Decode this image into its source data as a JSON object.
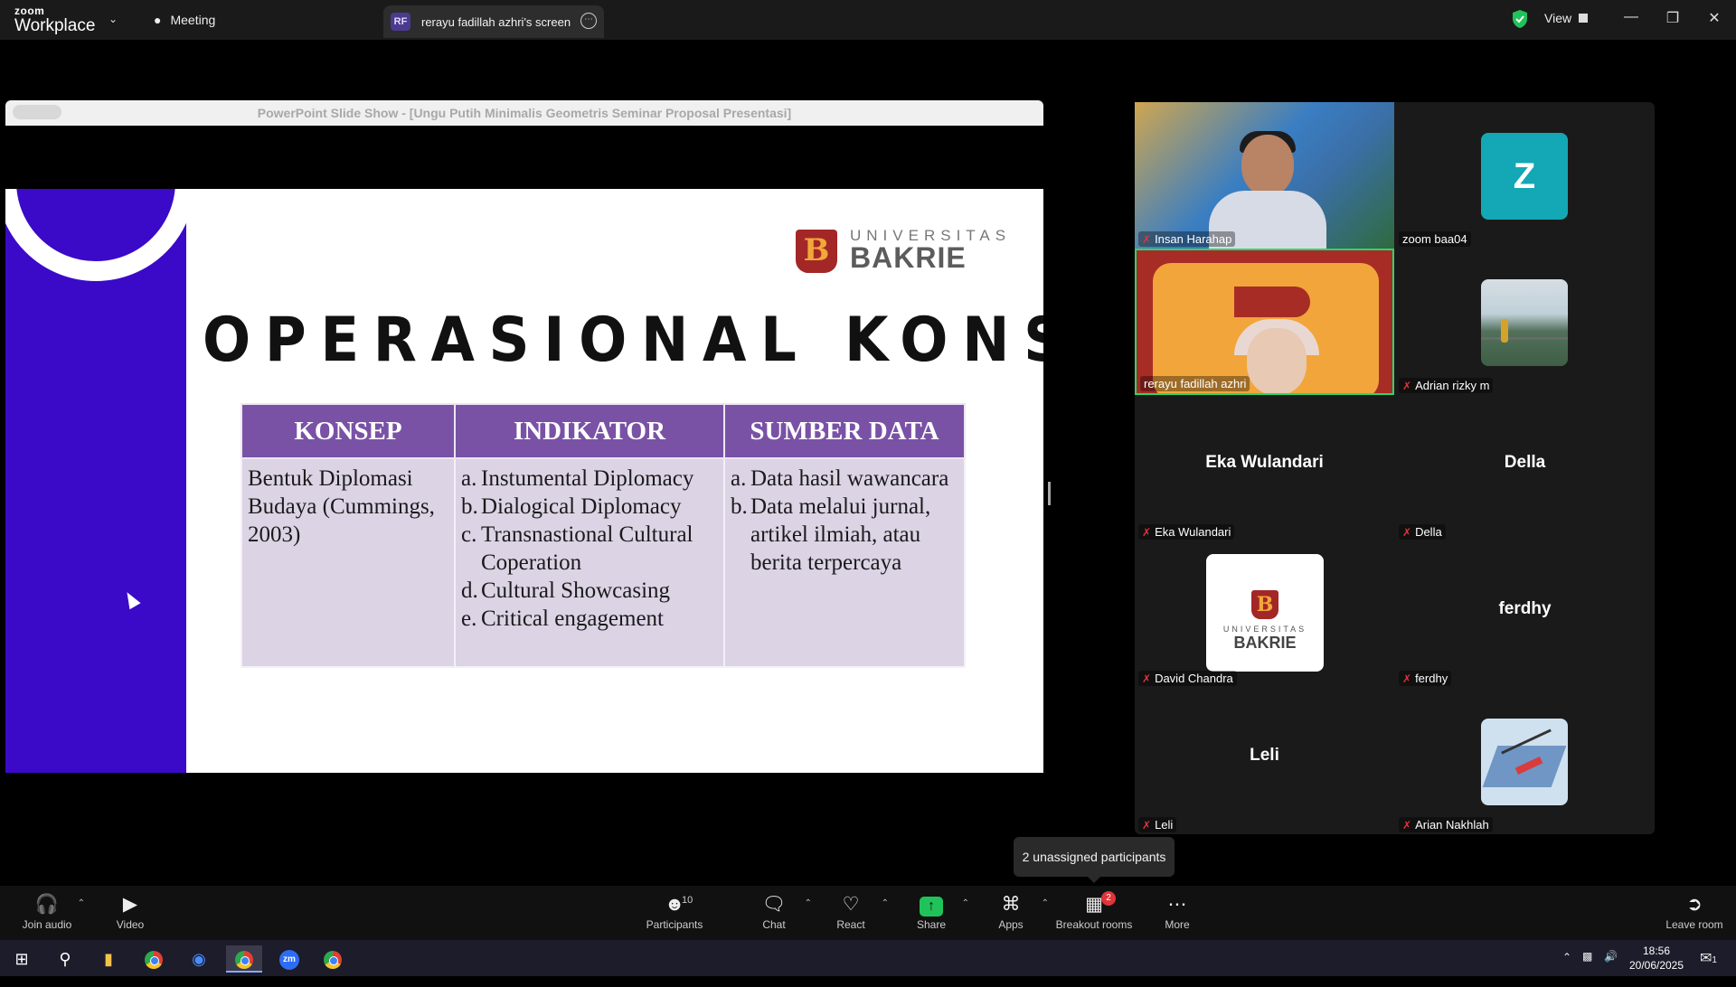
{
  "app": {
    "logo_top": "zoom",
    "logo_bottom": "Workplace"
  },
  "tabs": {
    "meeting": "Meeting",
    "screen_badge": "RF",
    "screen_tab": "rerayu fadillah azhri's screen"
  },
  "titlebar": {
    "view_label": "View"
  },
  "shared_window": {
    "title": "PowerPoint Slide Show - [Ungu Putih Minimalis Geometris Seminar Proposal Presentasi]",
    "slide": {
      "heading": "OPERASIONAL KONSEP",
      "logo_line1": "UNIVERSITAS",
      "logo_line2": "BAKRIE",
      "logo_mark": "B",
      "table": {
        "headers": [
          "KONSEP",
          "INDIKATOR",
          "SUMBER DATA"
        ],
        "konsep": "Bentuk Diplomasi Budaya (Cummings, 2003)",
        "indikator": [
          {
            "m": "a.",
            "t": "Instumental Diplomacy"
          },
          {
            "m": "b.",
            "t": "Dialogical Diplomacy"
          },
          {
            "m": "c.",
            "t": "Transnastional Cultural Coperation"
          },
          {
            "m": "d.",
            "t": "Cultural Showcasing"
          },
          {
            "m": "e.",
            "t": "Critical engagement"
          }
        ],
        "sumber": [
          {
            "m": "a.",
            "t": "Data hasil wawancara"
          },
          {
            "m": "b.",
            "t": "Data melalui jurnal, artikel ilmiah, atau berita terpercaya"
          }
        ]
      }
    }
  },
  "participants": [
    {
      "name": "Insan Harahap"
    },
    {
      "name": "zoom baa04",
      "avatar_letter": "Z"
    },
    {
      "name": "rerayu fadillah azhri"
    },
    {
      "name": "Adrian rizky m"
    },
    {
      "name": "Eka Wulandari",
      "display": "Eka Wulandari"
    },
    {
      "name": "Della",
      "display": "Della"
    },
    {
      "name": "David Chandra",
      "avatar_line1": "UNIVERSITAS",
      "avatar_line2": "BAKRIE",
      "avatar_mark": "B"
    },
    {
      "name": "ferdhy",
      "display": "ferdhy"
    },
    {
      "name": "Leli",
      "display": "Leli"
    },
    {
      "name": "Arian Nakhlah"
    }
  ],
  "tooltip": "2 unassigned participants",
  "toolbar": {
    "join_audio": "Join audio",
    "video": "Video",
    "participants": "Participants",
    "participants_count": "10",
    "chat": "Chat",
    "react": "React",
    "share": "Share",
    "apps": "Apps",
    "breakout": "Breakout rooms",
    "breakout_badge": "2",
    "more": "More",
    "leave": "Leave room"
  },
  "taskbar": {
    "time": "18:56",
    "date": "20/06/2025",
    "notif_count": "1"
  },
  "colors": {
    "slide_band": "#3a0ac8",
    "table_header": "#7952a6",
    "table_body": "#dcd3e5",
    "active_border": "#2bd66e",
    "share_green": "#20c35a",
    "alert_red": "#e0343a"
  }
}
